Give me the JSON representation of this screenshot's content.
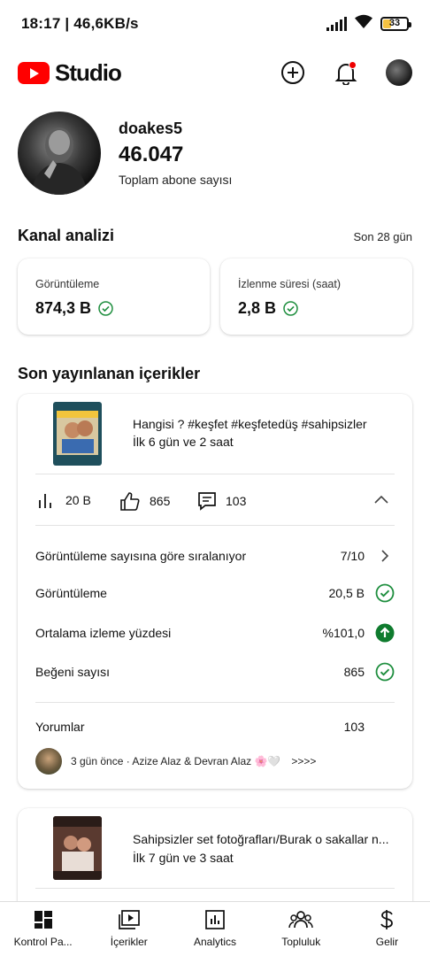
{
  "status_bar": {
    "time_speed": "18:17 | 46,6KB/s",
    "battery": "33"
  },
  "header": {
    "logo_text": "Studio",
    "brand_color": "#ff0000"
  },
  "channel": {
    "name": "doakes5",
    "subscribers": "46.047",
    "subscribers_label": "Toplam abone sayısı"
  },
  "analytics": {
    "title": "Kanal analizi",
    "period": "Son 28 gün",
    "views": {
      "label": "Görüntüleme",
      "value": "874,3 B"
    },
    "watch_time": {
      "label": "İzlenme süresi (saat)",
      "value": "2,8 B"
    }
  },
  "recent": {
    "title": "Son yayınlanan içerikler",
    "items": [
      {
        "title": "Hangisi ? #keşfet #keşfetedüş #sahipsizler",
        "age": "İlk 6 gün ve 2 saat",
        "stats": {
          "views": "20 B",
          "likes": "865",
          "comments": "103"
        },
        "details": {
          "ranking_label": "Görüntüleme sayısına göre sıralanıyor",
          "ranking_value": "7/10",
          "views_label": "Görüntüleme",
          "views_value": "20,5 B",
          "avg_label": "Ortalama izleme yüzdesi",
          "avg_value": "%101,0",
          "likes_label": "Beğeni sayısı",
          "likes_value": "865",
          "comments_label": "Yorumlar",
          "comments_value": "103",
          "comment_preview": "3 gün önce · Azize Alaz & Devran Alaz 🌸🤍",
          "comment_more": ">>>>"
        }
      },
      {
        "title": "Sahipsizler set fotoğrafları/Burak o sakallar n...",
        "age": "İlk 7 gün ve 3 saat"
      }
    ]
  },
  "colors": {
    "check": "#1e8e3e",
    "up_arrow": "#0f7b2e"
  },
  "nav": [
    {
      "label": "Kontrol Pa...",
      "icon": "dashboard-icon"
    },
    {
      "label": "İçerikler",
      "icon": "content-icon"
    },
    {
      "label": "Analytics",
      "icon": "analytics-icon"
    },
    {
      "label": "Topluluk",
      "icon": "community-icon"
    },
    {
      "label": "Gelir",
      "icon": "earn-icon"
    }
  ]
}
